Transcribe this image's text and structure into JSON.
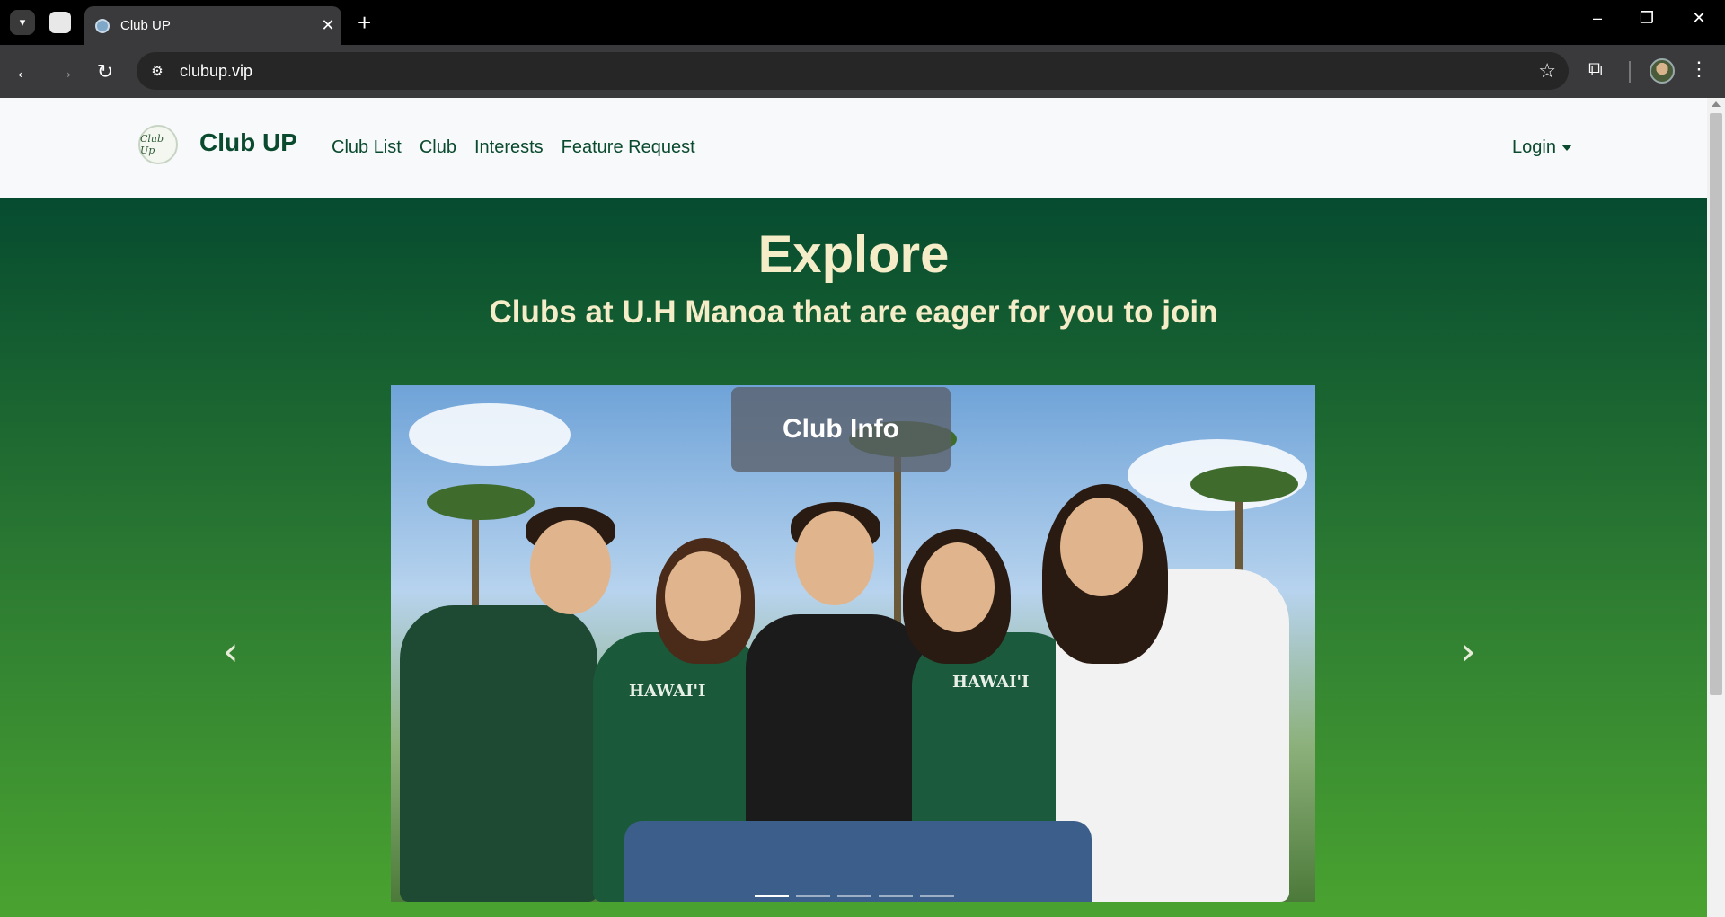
{
  "browser": {
    "tab_title": "Club UP",
    "url": "clubup.vip",
    "icons": [
      "tab-list-icon",
      "new-tab-icon",
      "close-tab-icon",
      "back-icon",
      "forward-icon",
      "reload-icon",
      "site-info-icon",
      "bookmark-star-icon",
      "extensions-icon",
      "profile-avatar",
      "menu-kebab-icon",
      "minimize-icon",
      "restore-icon",
      "close-window-icon"
    ]
  },
  "navbar": {
    "brand": "Club UP",
    "logo_text": "Club Up",
    "links": [
      "Club List",
      "Club",
      "Interests",
      "Feature Request"
    ],
    "login": "Login"
  },
  "hero": {
    "title": "Explore",
    "subtitle": "Clubs at U.H Manoa that are eager for you to join"
  },
  "carousel": {
    "caption": "Club Info",
    "shirt_text_1": "HAWAI'I",
    "shirt_text_2": "HAWAI'I",
    "slides": 5,
    "active_slide": 1,
    "prev_icon": "chevron-left-icon",
    "next_icon": "chevron-right-icon"
  },
  "colors": {
    "brand_green": "#0a4a2e",
    "hero_top": "#064b30",
    "hero_bottom": "#4aa330",
    "hero_text": "#f5ecc8"
  }
}
